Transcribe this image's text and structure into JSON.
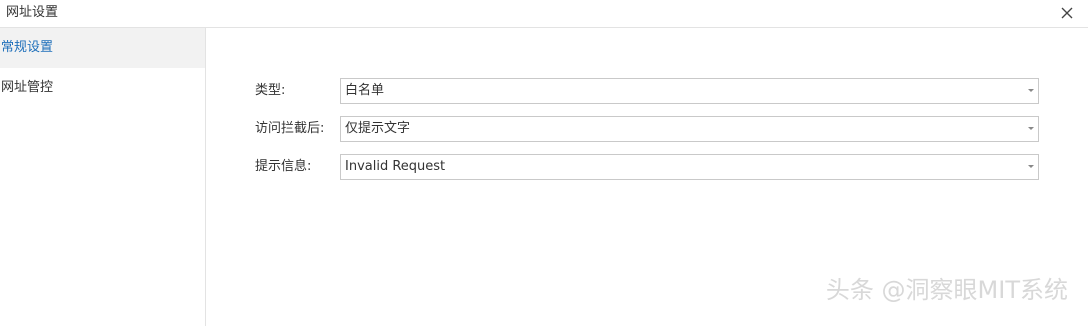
{
  "window": {
    "title": "网址设置",
    "close_icon": "close-icon"
  },
  "sidebar": {
    "items": [
      {
        "label": "常规设置",
        "active": true
      },
      {
        "label": "网址管控",
        "active": false
      }
    ]
  },
  "form": {
    "type": {
      "label": "类型:",
      "value": "白名单"
    },
    "after_intercept": {
      "label": "访问拦截后:",
      "value": "仅提示文字"
    },
    "prompt": {
      "label": "提示信息:",
      "value": "Invalid Request"
    }
  },
  "watermark": "头条 @洞察眼MIT系统",
  "colors": {
    "accent": "#1e6fba",
    "active_bg": "#f2f2f2",
    "border": "#c9c9c9"
  }
}
